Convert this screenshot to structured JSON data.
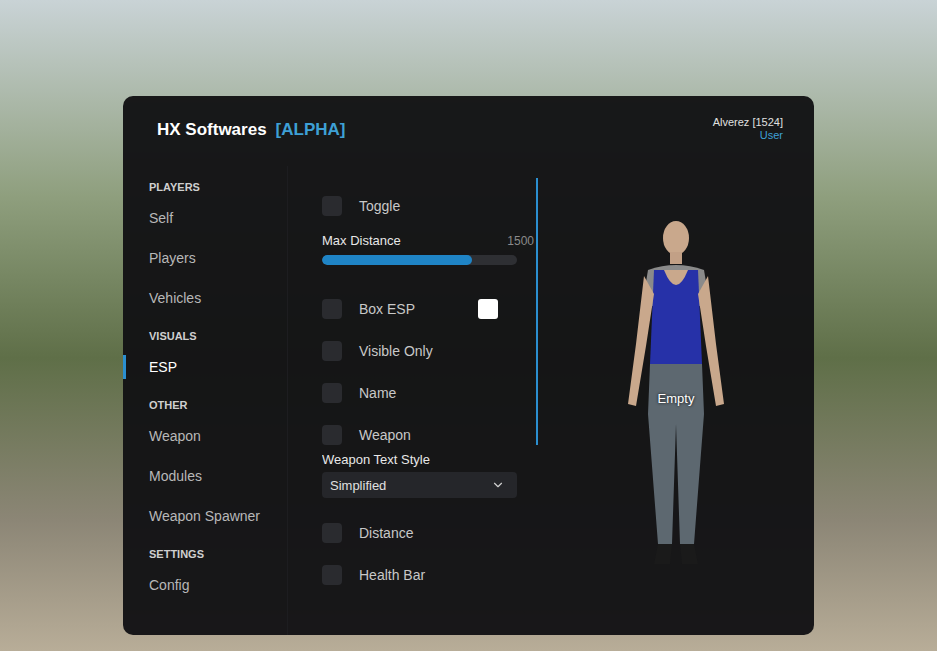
{
  "window": {
    "title": "HX Softwares",
    "badge": "[ALPHA]"
  },
  "user": {
    "name": "Alverez [1524]",
    "role": "User"
  },
  "sidebar": {
    "sections": [
      {
        "heading": "PLAYERS",
        "items": [
          {
            "label": "Self",
            "selected": false
          },
          {
            "label": "Players",
            "selected": false
          },
          {
            "label": "Vehicles",
            "selected": false
          }
        ]
      },
      {
        "heading": "VISUALS",
        "items": [
          {
            "label": "ESP",
            "selected": true
          }
        ]
      },
      {
        "heading": "OTHER",
        "items": [
          {
            "label": "Weapon",
            "selected": false
          },
          {
            "label": "Modules",
            "selected": false
          },
          {
            "label": "Weapon Spawner",
            "selected": false
          }
        ]
      },
      {
        "heading": "SETTINGS",
        "items": [
          {
            "label": "Config",
            "selected": false
          }
        ]
      }
    ]
  },
  "options": [
    {
      "kind": "checkbox",
      "label": "Toggle",
      "checked": false
    },
    {
      "kind": "slider",
      "label": "Max Distance",
      "value": "1500",
      "level": 0.77
    },
    {
      "kind": "checkbox",
      "label": "Box ESP",
      "checked": false,
      "color": "#ffffff"
    },
    {
      "kind": "checkbox",
      "label": "Visible Only",
      "checked": false
    },
    {
      "kind": "checkbox",
      "label": "Name",
      "checked": false
    },
    {
      "kind": "checkbox",
      "label": "Weapon",
      "checked": false
    },
    {
      "kind": "select",
      "label": "Weapon Text Style",
      "value": "Simplified"
    },
    {
      "kind": "checkbox",
      "label": "Distance",
      "checked": false
    },
    {
      "kind": "checkbox",
      "label": "Health Bar",
      "checked": false
    }
  ],
  "preview": {
    "label": "Empty"
  }
}
